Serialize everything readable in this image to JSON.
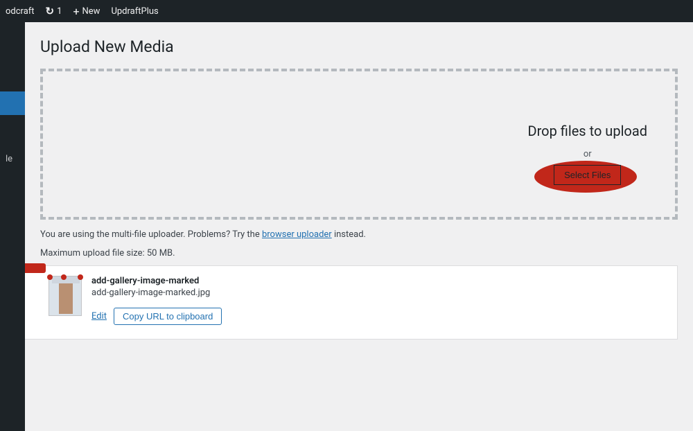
{
  "adminbar": {
    "site": "odcraft",
    "updates": "1",
    "new": "New",
    "updraft": "UpdraftPlus"
  },
  "sidebar": {
    "item_le": "le"
  },
  "page": {
    "title": "Upload New Media"
  },
  "dropzone": {
    "drop_text": "Drop files to upload",
    "or": "or",
    "select_btn": "Select Files"
  },
  "help": {
    "prefix": "You are using the multi-file uploader. Problems? Try the ",
    "link": "browser uploader",
    "suffix": " instead."
  },
  "limits": {
    "max": "Maximum upload file size: 50 MB."
  },
  "uploaded": {
    "title": "add-gallery-image-marked",
    "filename": "add-gallery-image-marked.jpg",
    "edit": "Edit",
    "copy": "Copy URL to clipboard"
  }
}
